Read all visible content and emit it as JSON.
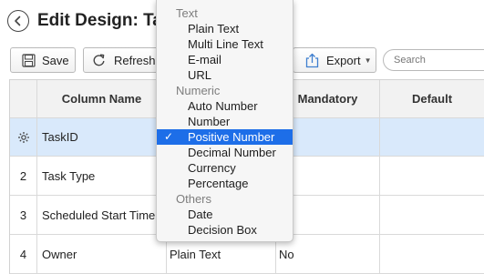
{
  "page": {
    "title": "Edit Design: Ta"
  },
  "toolbar": {
    "save_label": "Save",
    "refresh_label": "Refresh",
    "export_label": "Export",
    "search_placeholder": "Search"
  },
  "table": {
    "headers": [
      "Column Name",
      "Mandatory",
      "Default"
    ],
    "rows": [
      {
        "num": "",
        "name": "TaskID",
        "type": "",
        "mandatory": "",
        "default": "",
        "selected": true
      },
      {
        "num": "2",
        "name": "Task Type",
        "type": "",
        "mandatory": "",
        "default": ""
      },
      {
        "num": "3",
        "name": "Scheduled Start Time",
        "type": "",
        "mandatory": "",
        "default": ""
      },
      {
        "num": "4",
        "name": "Owner",
        "type": "Plain Text",
        "mandatory": "No",
        "default": ""
      }
    ]
  },
  "dropdown": {
    "groups": [
      {
        "label": "Text",
        "items": [
          "Plain Text",
          "Multi Line Text",
          "E-mail",
          "URL"
        ]
      },
      {
        "label": "Numeric",
        "items": [
          "Auto Number",
          "Number",
          "Positive Number",
          "Decimal Number",
          "Currency",
          "Percentage"
        ]
      },
      {
        "label": "Others",
        "items": [
          "Date",
          "Decision Box"
        ]
      }
    ],
    "selected": "Positive Number",
    "check_glyph": "✓"
  },
  "colors": {
    "selection_highlight": "#1d6ee8",
    "selected_row": "#d9e9fb",
    "header_bg": "#f2f2f2"
  },
  "icons": [
    "back-arrow-icon",
    "save-icon",
    "refresh-icon",
    "export-icon",
    "caret-down-icon",
    "row-settings-icon",
    "checkmark-icon"
  ]
}
